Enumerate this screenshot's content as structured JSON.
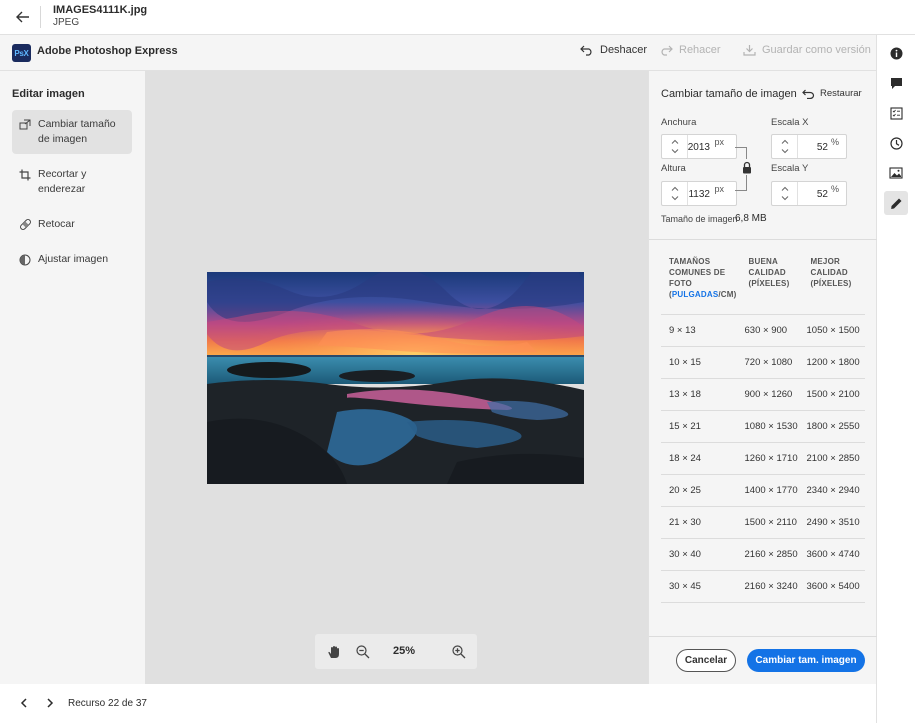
{
  "file": {
    "name": "IMAGES4111K.jpg",
    "type": "JPEG"
  },
  "app": {
    "logo_text": "PsX",
    "name": "Adobe Photoshop Express",
    "undo_label": "Deshacer",
    "redo_label": "Rehacer",
    "save_version_label": "Guardar como versión"
  },
  "left_panel": {
    "title": "Editar imagen",
    "items": [
      {
        "label": "Cambiar tamaño de imagen",
        "icon": "resize-icon",
        "selected": true
      },
      {
        "label": "Recortar y enderezar",
        "icon": "crop-icon",
        "selected": false
      },
      {
        "label": "Retocar",
        "icon": "bandage-icon",
        "selected": false
      },
      {
        "label": "Ajustar imagen",
        "icon": "adjust-icon",
        "selected": false
      }
    ]
  },
  "canvas": {
    "zoom_level": "25%"
  },
  "resize_panel": {
    "title": "Cambiar tamaño de imagen",
    "restore_label": "Restaurar",
    "width_label": "Anchura",
    "width_value": "2013",
    "height_label": "Altura",
    "height_value": "1132",
    "px_unit": "px",
    "scale_x_label": "Escala X",
    "scale_x_value": "52",
    "scale_y_label": "Escala Y",
    "scale_y_value": "52",
    "pct_unit": "%",
    "file_size_label": "Tamaño de imagen",
    "file_size_value": "6,8 MB"
  },
  "sizes_table": {
    "header_col1_line1": "TAMAÑOS",
    "header_col1_line2": "COMUNES DE",
    "header_col1_line3": "FOTO",
    "header_col1_open": "(",
    "header_col1_units_blue": "PULGADAS",
    "header_col1_units_rest": "/CM)",
    "header_col2_line1": "BUENA",
    "header_col2_line2": "CALIDAD",
    "header_col2_line3": "(PÍXELES)",
    "header_col3_line1": "MEJOR",
    "header_col3_line2": "CALIDAD",
    "header_col3_line3": "(PÍXELES)",
    "rows": [
      {
        "size": "9 × 13",
        "good": "630 × 900",
        "best": "1050 × 1500"
      },
      {
        "size": "10 × 15",
        "good": "720 × 1080",
        "best": "1200 × 1800"
      },
      {
        "size": "13 × 18",
        "good": "900 × 1260",
        "best": "1500 × 2100"
      },
      {
        "size": "15 × 21",
        "good": "1080 × 1530",
        "best": "1800 × 2550"
      },
      {
        "size": "18 × 24",
        "good": "1260 × 1710",
        "best": "2100 × 2850"
      },
      {
        "size": "20 × 25",
        "good": "1400 × 1770",
        "best": "2340 × 2940"
      },
      {
        "size": "21 × 30",
        "good": "1500 × 2110",
        "best": "2490 × 3510"
      },
      {
        "size": "30 × 40",
        "good": "2160 × 2850",
        "best": "3600 × 4740"
      },
      {
        "size": "30 × 45",
        "good": "2160 × 3240",
        "best": "3600 × 5400"
      }
    ]
  },
  "actions": {
    "cancel_label": "Cancelar",
    "apply_label": "Cambiar tam. imagen"
  },
  "bottom_nav": {
    "resource_text": "Recurso 22 de 37"
  },
  "rail": [
    {
      "icon": "info-icon",
      "active": false
    },
    {
      "icon": "comment-icon",
      "active": false
    },
    {
      "icon": "checklist-icon",
      "active": false
    },
    {
      "icon": "history-icon",
      "active": false
    },
    {
      "icon": "image-icon",
      "active": false
    },
    {
      "icon": "pencil-icon",
      "active": true
    }
  ],
  "colors": {
    "accent": "#1473e6",
    "panel_bg": "#f5f5f5",
    "canvas_bg": "#e0e0e0"
  }
}
